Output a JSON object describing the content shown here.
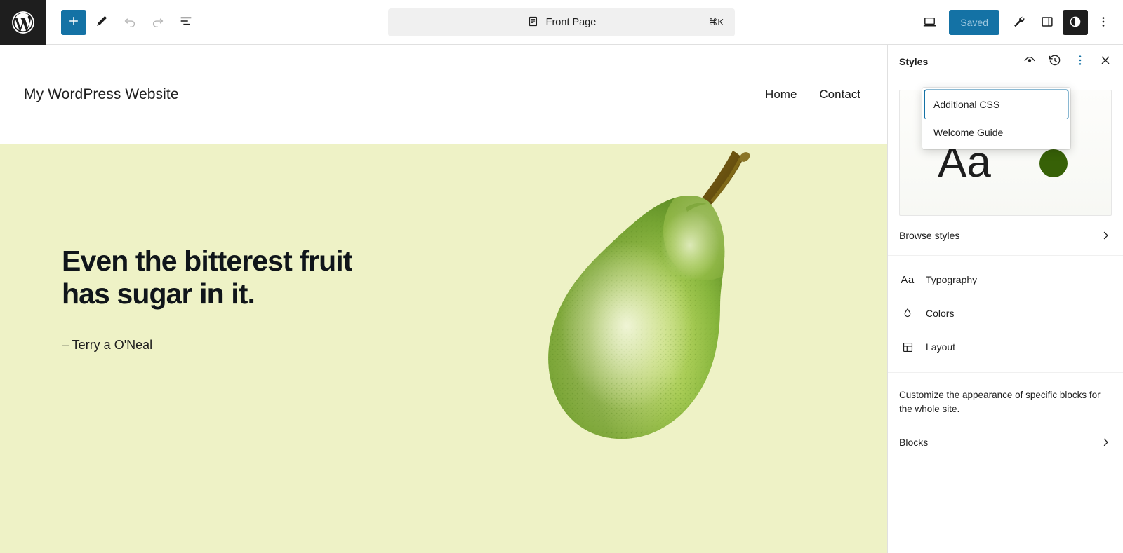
{
  "toolbar": {
    "wp_logo_label": "WordPress",
    "add_block_label": "+",
    "tools": [
      {
        "name": "add-block-button",
        "icon": "plus-icon",
        "label": "Add block"
      },
      {
        "name": "edit-tool-button",
        "icon": "pencil-icon",
        "label": "Edit"
      },
      {
        "name": "undo-button",
        "icon": "undo-icon",
        "label": "Undo"
      },
      {
        "name": "redo-button",
        "icon": "redo-icon",
        "label": "Redo"
      },
      {
        "name": "list-view-button",
        "icon": "list-view-icon",
        "label": "Document Overview"
      }
    ],
    "command_bar": {
      "icon": "page-icon",
      "title": "Front Page",
      "shortcut": "⌘K"
    },
    "right": {
      "device_preview_label": "View",
      "save_label": "Saved",
      "settings_label": "Settings",
      "sidebar_label": "Settings sidebar",
      "styles_label": "Styles",
      "options_label": "Options"
    }
  },
  "site": {
    "title": "My WordPress Website",
    "nav": [
      "Home",
      "Contact"
    ],
    "hero": {
      "quote_line1": "Even the bitterest fruit",
      "quote_line2": "has sugar in it.",
      "attribution": "– Terry a O'Neal",
      "background_color": "#eef2c6",
      "image_alt": "green pear"
    }
  },
  "sidebar": {
    "title": "Styles",
    "actions": [
      {
        "name": "style-book-button",
        "icon": "eye-icon",
        "label": "Style Book"
      },
      {
        "name": "revisions-button",
        "icon": "revisions-icon",
        "label": "Revisions"
      },
      {
        "name": "more-menu-button",
        "icon": "more-vertical-icon",
        "label": "More"
      },
      {
        "name": "close-styles-button",
        "icon": "close-icon",
        "label": "Close Styles"
      }
    ],
    "preview": {
      "sample_text": "Aa",
      "swatch_color": "#376107"
    },
    "browse_styles": "Browse styles",
    "items": [
      {
        "label": "Typography",
        "icon": "typography-icon"
      },
      {
        "label": "Colors",
        "icon": "droplet-icon"
      },
      {
        "label": "Layout",
        "icon": "layout-icon"
      }
    ],
    "blocks_description": "Customize the appearance of specific blocks for the whole site.",
    "blocks_label": "Blocks"
  },
  "dropdown": {
    "items": [
      {
        "label": "Additional CSS",
        "focused": true
      },
      {
        "label": "Welcome Guide",
        "focused": false
      }
    ]
  },
  "colors": {
    "accent": "#1472a5",
    "dark": "#1e1e1e",
    "canvas_bg": "#eef2c6",
    "swatch_green": "#376107"
  }
}
